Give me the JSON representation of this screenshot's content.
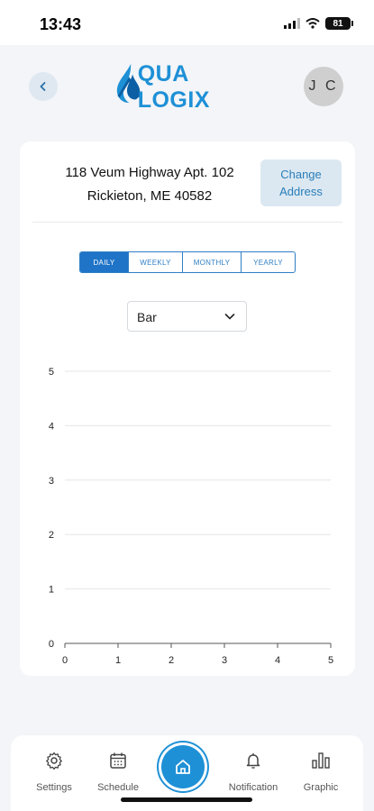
{
  "status": {
    "time": "13:43",
    "battery": "81"
  },
  "header": {
    "logo_text": "QUA LOGIX",
    "avatar_initials": "J C"
  },
  "address": {
    "line1": "118 Veum Highway Apt. 102",
    "line2": "Rickieton, ME 40582",
    "change_label_1": "Change",
    "change_label_2": "Address"
  },
  "tabs": [
    {
      "label": "DAILY",
      "active": true
    },
    {
      "label": "WEEKLY",
      "active": false
    },
    {
      "label": "MONTHLY",
      "active": false
    },
    {
      "label": "YEARLY",
      "active": false
    }
  ],
  "chart_type_select": {
    "value": "Bar"
  },
  "chart_data": {
    "type": "bar",
    "x_ticks": [
      "0",
      "1",
      "2",
      "3",
      "4",
      "5"
    ],
    "y_ticks": [
      "0",
      "1",
      "2",
      "3",
      "4",
      "5"
    ],
    "xlim": [
      0,
      5
    ],
    "ylim": [
      0,
      5
    ],
    "values": [],
    "grid": true
  },
  "nav": {
    "settings": "Settings",
    "schedule": "Schedule",
    "notification": "Notification",
    "graphic": "Graphic"
  },
  "colors": {
    "accent": "#1e90d6",
    "tab_active": "#1f74c8"
  }
}
